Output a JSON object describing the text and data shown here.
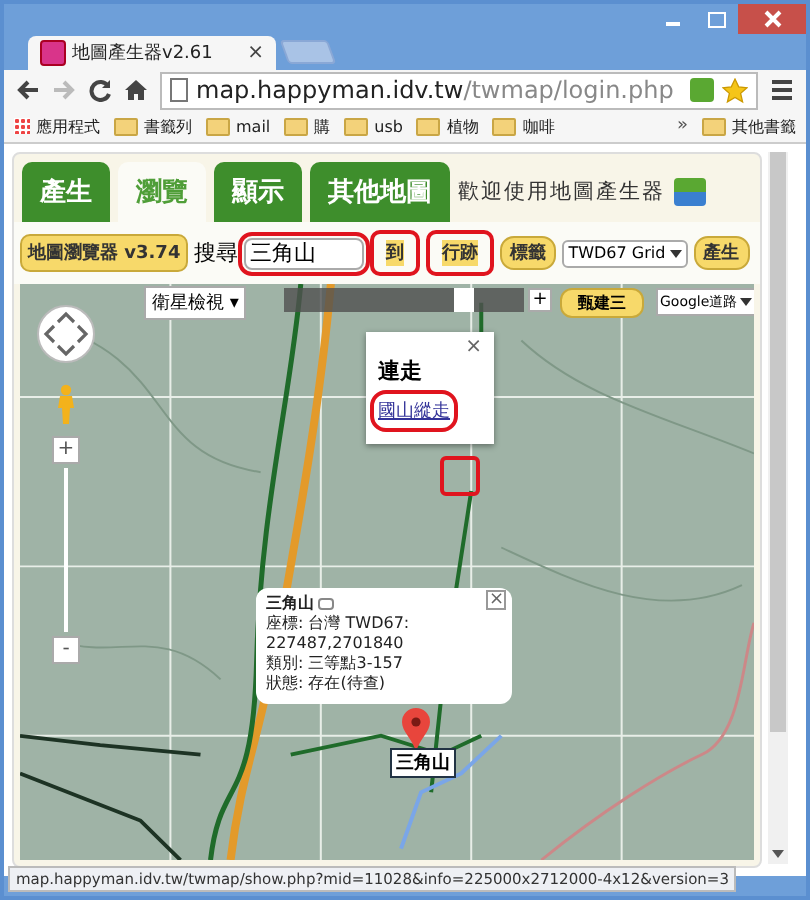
{
  "window": {
    "tab_title": "地圖產生器v2.61",
    "close_tab": "×",
    "address": {
      "host": "map.happyman.idv.tw",
      "path": "/twmap/login.php"
    },
    "bookmarks": [
      {
        "label": "應用程式",
        "kind": "apps"
      },
      {
        "label": "書籤列",
        "kind": "folder"
      },
      {
        "label": "mail",
        "kind": "folder"
      },
      {
        "label": "購",
        "kind": "folder"
      },
      {
        "label": "usb",
        "kind": "folder"
      },
      {
        "label": "植物",
        "kind": "folder"
      },
      {
        "label": "咖啡",
        "kind": "folder"
      }
    ],
    "overflow": "»",
    "other_bookmarks": "其他書籤"
  },
  "tabs": [
    {
      "label": "產生",
      "selected": false
    },
    {
      "label": "瀏覽",
      "selected": true
    },
    {
      "label": "顯示",
      "selected": false
    },
    {
      "label": "其他地圖",
      "selected": false
    }
  ],
  "welcome": "歡迎使用地圖產生器",
  "toolbar": {
    "badge": "地圖瀏覽器 v3.74",
    "search_label": "搜尋",
    "search_value": "三角山",
    "search_highlighted": true,
    "buttons": [
      {
        "label": "到",
        "highlighted": true
      },
      {
        "label": "行跡",
        "highlighted": true
      },
      {
        "label": "標籤",
        "highlighted": false
      }
    ],
    "grid_select": "TWD67 Grid",
    "generate": "產生"
  },
  "map": {
    "view_menu": "衛星檢視 ▾",
    "zoom_plus": "+",
    "zoom_minus": "-",
    "preset": "甄建三",
    "layer_select": "Google道路",
    "point_highlighted": true,
    "popup": {
      "title": "連走",
      "link": "國山縱走",
      "link_highlighted": true,
      "close": "×"
    },
    "opacity": {
      "level": 0.77
    },
    "info": {
      "title": "三角山",
      "close": "×",
      "lines": [
        "座標: 台灣 TWD67:",
        "227487,2701840",
        "類別: 三等點3-157",
        "狀態: 存在(待查)"
      ]
    },
    "marker_label": "三角山"
  },
  "status_bar": "map.happyman.idv.tw/twmap/show.php?mid=11028&info=225000x2712000-4x12&version=3"
}
